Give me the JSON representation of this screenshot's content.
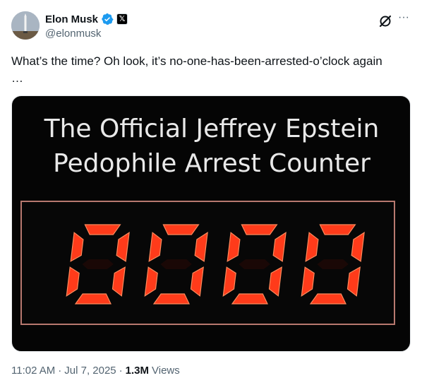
{
  "author": {
    "display_name": "Elon Musk",
    "handle": "@elonmusk",
    "avatar_icon": "avatar-icon",
    "affiliation_badge": "𝕏",
    "accent_color": "#1d9bf0"
  },
  "tweet": {
    "text": "What’s the time? Oh look, it’s no-one-has-been-arrested-o’clock again\n…"
  },
  "media": {
    "title_line1": "The Official Jeffrey Epstein",
    "title_line2": "Pedophile Arrest Counter",
    "counter_value": "0000",
    "digit_color": "#ff3b1a"
  },
  "meta": {
    "time": "11:02 AM",
    "sep1": "·",
    "date": "Jul 7, 2025",
    "sep2": "·",
    "views_count": "1.3M",
    "views_label": "Views"
  }
}
